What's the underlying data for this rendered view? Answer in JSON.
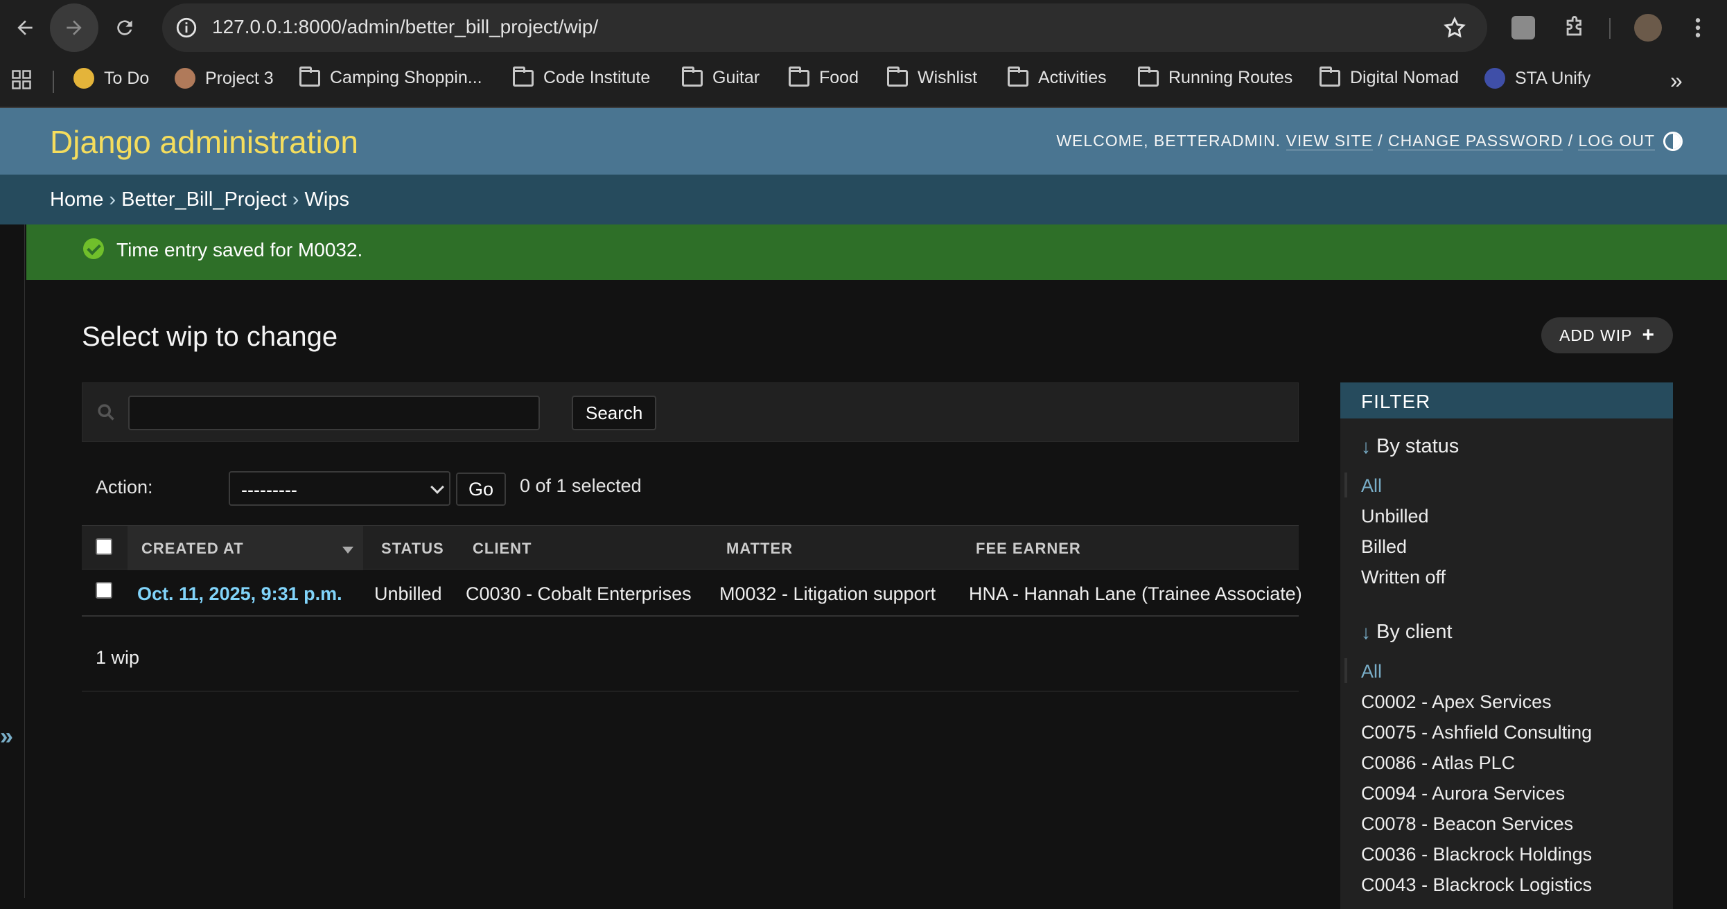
{
  "browser": {
    "url": "127.0.0.1:8000/admin/better_bill_project/wip/",
    "bookmarks": [
      "To Do",
      "Project 3",
      "Camping Shoppin...",
      "Code Institute",
      "Guitar",
      "Food",
      "Wishlist",
      "Activities",
      "Running Routes",
      "Digital Nomad",
      "STA Unify"
    ],
    "more_bookmarks": "»"
  },
  "header": {
    "brand": "Django administration",
    "welcome": "WELCOME, BETTERADMIN.",
    "view_site": "VIEW SITE",
    "change_password": "CHANGE PASSWORD",
    "log_out": "LOG OUT",
    "sep": "/"
  },
  "breadcrumbs": [
    "Home",
    "Better_Bill_Project",
    "Wips"
  ],
  "breadcrumb_sep": "›",
  "message": "Time entry saved for M0032.",
  "sidebar_toggle": "»",
  "page": {
    "title": "Select wip to change",
    "add_label": "ADD WIP",
    "search_button": "Search",
    "search_value": "",
    "action_label": "Action:",
    "action_value": "---------",
    "go_label": "Go",
    "selected_text": "0 of 1 selected",
    "result_count": "1 wip"
  },
  "table": {
    "headers": [
      "CREATED AT",
      "STATUS",
      "CLIENT",
      "MATTER",
      "FEE EARNER"
    ],
    "rows": [
      {
        "created_at": "Oct. 11, 2025, 9:31 p.m.",
        "status": "Unbilled",
        "client": "C0030 - Cobalt Enterprises",
        "matter": "M0032 - Litigation support",
        "fee_earner": "HNA - Hannah Lane (Trainee Associate)"
      }
    ]
  },
  "filter": {
    "title": "FILTER",
    "by_status_title": "By status",
    "status_options": [
      "All",
      "Unbilled",
      "Billed",
      "Written off"
    ],
    "by_client_title": "By client",
    "client_options": [
      "All",
      "C0002 - Apex Services",
      "C0075 - Ashfield Consulting",
      "C0086 - Atlas PLC",
      "C0094 - Aurora Services",
      "C0078 - Beacon Services",
      "C0036 - Blackrock Holdings",
      "C0043 - Blackrock Logistics"
    ]
  },
  "colors": {
    "header_bg": "#4a7591",
    "brand": "#f5dd5d",
    "breadcrumb_bg": "#264b5d",
    "success_bg": "#2e6f28",
    "link": "#81d4fa"
  }
}
